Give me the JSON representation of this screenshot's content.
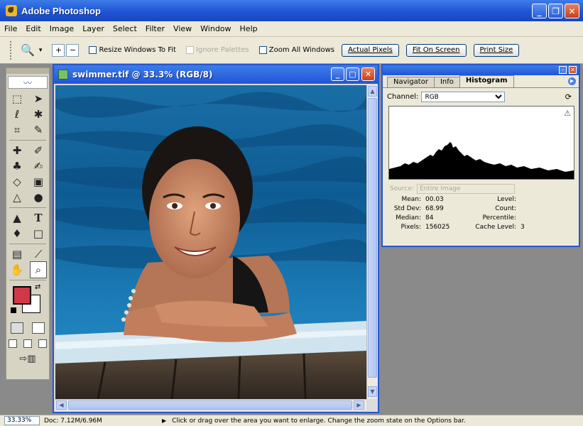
{
  "app": {
    "title": "Adobe Photoshop"
  },
  "menu": [
    "File",
    "Edit",
    "Image",
    "Layer",
    "Select",
    "Filter",
    "View",
    "Window",
    "Help"
  ],
  "options": {
    "resize_windows": "Resize Windows To Fit",
    "ignore_palettes": "Ignore Palettes",
    "zoom_all": "Zoom All Windows",
    "actual_pixels": "Actual Pixels",
    "fit_on_screen": "Fit On Screen",
    "print_size": "Print Size"
  },
  "document": {
    "title": "swimmer.tif @ 33.3% (RGB/8)"
  },
  "palette": {
    "tabs": [
      "Navigator",
      "Info",
      "Histogram"
    ],
    "channel_label": "Channel:",
    "channel_value": "RGB",
    "source_label": "Source:",
    "source_value": "Entire Image",
    "stats": {
      "mean_label": "Mean:",
      "mean": "00.03",
      "stddev_label": "Std Dev:",
      "stddev": "68.99",
      "median_label": "Median:",
      "median": "84",
      "pixels_label": "Pixels:",
      "pixels": "156025",
      "level_label": "Level:",
      "count_label": "Count:",
      "percentile_label": "Percentile:",
      "cache_label": "Cache Level:",
      "cache": "3"
    }
  },
  "colors": {
    "foreground": "#d03848",
    "background": "#ffffff",
    "accent": "#2457d0"
  },
  "status": {
    "zoom": "33.33%",
    "doc": "Doc: 7.12M/6.96M",
    "hint": "Click or drag over the area you want to enlarge. Change the zoom state on the Options bar."
  }
}
